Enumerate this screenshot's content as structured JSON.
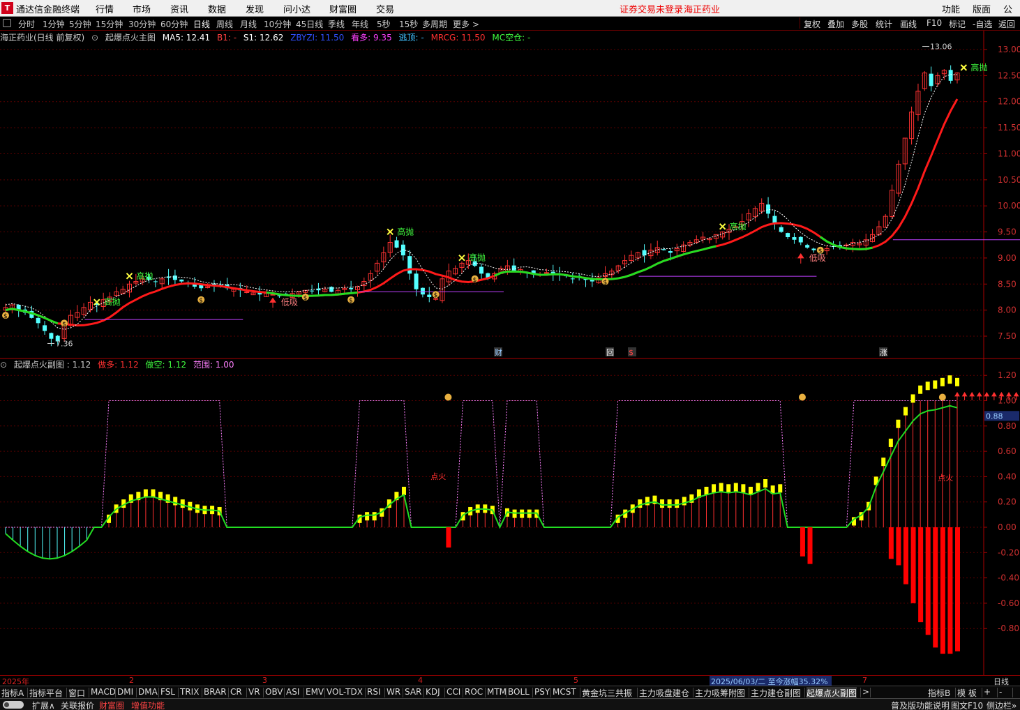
{
  "menubar": {
    "logo": "T",
    "app_title": "通达信金融终端",
    "items": [
      "行情",
      "市场",
      "资讯",
      "数据",
      "发现",
      "问小达",
      "财富圈",
      "交易"
    ],
    "login_status": "证券交易未登录",
    "stock_name": "海正药业",
    "right_items": [
      "功能",
      "版面",
      "公式"
    ]
  },
  "periodbar": {
    "periods": [
      "分时",
      "1分钟",
      "5分钟",
      "15分钟",
      "30分钟",
      "60分钟",
      "日线",
      "周线",
      "月线",
      "10分钟",
      "45日线",
      "季线",
      "年线",
      "5秒",
      "15秒",
      "多周期",
      "更多 >"
    ],
    "active": "日线",
    "right_buttons": [
      "复权",
      "叠加",
      "多股",
      "统计",
      "画线",
      "F10",
      "标记",
      "-自选",
      "返回"
    ]
  },
  "main_header": {
    "title": "海正药业(日线 前复权)",
    "indicator": "起爆点火主图",
    "ma5": "MA5: 12.41",
    "b1": "B1: -",
    "s1": "S1: 12.62",
    "zbyzi": "ZBYZI: 11.50",
    "kanduo": "看多: 9.35",
    "taoding": "逃顶: -",
    "mrcg": "MRCG: 11.50",
    "mckc": "MC空仓: -",
    "colors": {
      "title": "#cccccc",
      "b1": "#ff4040",
      "zbyzi": "#3050ff",
      "kanduo": "#ff40ff",
      "taoding": "#40c0ff",
      "mrcg": "#ff3030",
      "mckc": "#40ff40"
    }
  },
  "sub_header": {
    "title": "起爆点火副图 : 1.12",
    "zuoduo": "做多: 1.12",
    "zuokong": "做空: 1.12",
    "fanwei": "范围: 1.00"
  },
  "main_axis": [
    "13.00",
    "12.50",
    "12.00",
    "11.50",
    "11.00",
    "10.50",
    "10.00",
    "9.50",
    "9.00",
    "8.50",
    "8.00",
    "7.50"
  ],
  "sub_axis": [
    "1.20",
    "1.00",
    "0.80",
    "0.60",
    "0.40",
    "0.20",
    "0.00",
    "-0.20",
    "-0.40",
    "-0.60",
    "-0.80"
  ],
  "sub_axis_marker": "0.88",
  "annotations": {
    "high_price": "13.06",
    "low_price": "7.36",
    "gaopao": "高抛",
    "dixi": "低吸",
    "dianhuo": "点火",
    "cai": "财",
    "hui": "回",
    "zhang": "涨",
    "dollar": "$"
  },
  "timeaxis": {
    "labels": [
      "2025年",
      "2",
      "3",
      "4",
      "5",
      "7"
    ],
    "date_box": "2025/06/03/二  至今涨幅35.32%",
    "period": "日线"
  },
  "indicator_tabs": [
    "指标A",
    "指标平台",
    "窗口",
    "MACD",
    "DMI",
    "DMA",
    "FSL",
    "TRIX",
    "BRAR",
    "CR",
    "VR",
    "OBV",
    "ASI",
    "EMV",
    "VOL-TDX",
    "RSI",
    "WR",
    "SAR",
    "KDJ",
    "CCI",
    "ROC",
    "MTM",
    "BOLL",
    "PSY",
    "MCST",
    "黄金坑三共振",
    "主力吸盘建仓",
    "主力吸筹附图",
    "主力建仓副图",
    "起爆点火副图",
    ">",
    "指标B",
    "模 板",
    "+",
    "-"
  ],
  "indicator_active": "起爆点火副图",
  "statusbar": {
    "items": [
      "扩展∧",
      "关联报价",
      "财富圈",
      "增值功能"
    ],
    "right_items": [
      "普及版功能说明",
      "图文F10",
      "侧边栏»"
    ]
  },
  "chart_data": [
    {
      "type": "candlestick",
      "title": "海正药业(日线 前复权)",
      "ylim": [
        7.2,
        13.2
      ],
      "close": [
        8.05,
        8.1,
        8.0,
        7.95,
        7.85,
        7.75,
        7.6,
        7.45,
        7.4,
        7.7,
        7.9,
        7.95,
        8.05,
        8.15,
        8.1,
        8.2,
        8.25,
        8.35,
        8.4,
        8.5,
        8.55,
        8.6,
        8.58,
        8.55,
        8.6,
        8.62,
        8.58,
        8.55,
        8.5,
        8.45,
        8.42,
        8.45,
        8.48,
        8.45,
        8.42,
        8.4,
        8.38,
        8.35,
        8.33,
        8.3,
        8.32,
        8.3,
        8.28,
        8.3,
        8.32,
        8.35,
        8.38,
        8.36,
        8.38,
        8.4,
        8.35,
        8.38,
        8.42,
        8.4,
        8.45,
        8.55,
        8.7,
        8.9,
        9.1,
        9.3,
        9.2,
        9.05,
        8.7,
        8.4,
        8.3,
        8.25,
        8.22,
        8.6,
        8.75,
        8.8,
        8.9,
        8.95,
        8.85,
        8.7,
        8.6,
        8.7,
        8.8,
        8.85,
        8.75,
        8.78,
        8.72,
        8.7,
        8.68,
        8.72,
        8.7,
        8.68,
        8.65,
        8.6,
        8.62,
        8.58,
        8.55,
        8.62,
        8.7,
        8.75,
        8.85,
        8.95,
        9.05,
        9.1,
        9.05,
        9.15,
        9.2,
        9.15,
        9.1,
        9.18,
        9.25,
        9.3,
        9.35,
        9.4,
        9.38,
        9.45,
        9.5,
        9.55,
        9.6,
        9.7,
        9.85,
        9.95,
        10.05,
        9.85,
        9.65,
        9.5,
        9.4,
        9.35,
        9.3,
        9.2,
        9.15,
        9.1,
        9.18,
        9.22,
        9.2,
        9.25,
        9.3,
        9.28,
        9.35,
        9.45,
        9.6,
        9.8,
        10.3,
        10.8,
        11.3,
        11.8,
        12.2,
        12.55,
        12.3,
        12.5,
        12.6,
        12.4,
        12.55
      ],
      "ma_red_start": 8.0,
      "ma_red_end": 11.5
    },
    {
      "type": "bar",
      "title": "起爆点火副图",
      "ylim": [
        -1.1,
        1.3
      ],
      "values_up": [
        0,
        0,
        0,
        0,
        0,
        0,
        0,
        0,
        0,
        0,
        0,
        0,
        0,
        0,
        0.1,
        0.18,
        0.22,
        0.26,
        0.28,
        0.3,
        0.3,
        0.28,
        0.26,
        0.24,
        0.22,
        0.2,
        0.18,
        0.17,
        0.17,
        0.16,
        0,
        0,
        0,
        0,
        0,
        0,
        0,
        0,
        0,
        0,
        0,
        0,
        0,
        0,
        0,
        0,
        0,
        0,
        0.1,
        0.12,
        0.12,
        0.15,
        0.22,
        0.28,
        0.32,
        0,
        0,
        0,
        0,
        0,
        0,
        0,
        0.12,
        0.16,
        0.18,
        0.18,
        0.17,
        0,
        0.15,
        0.14,
        0.14,
        0.14,
        0.14,
        0,
        0,
        0,
        0,
        0,
        0,
        0,
        0,
        0,
        0,
        0.1,
        0.14,
        0.18,
        0.22,
        0.24,
        0.25,
        0.22,
        0.22,
        0.22,
        0.24,
        0.26,
        0.3,
        0.32,
        0.34,
        0.35,
        0.34,
        0.35,
        0.34,
        0.32,
        0.35,
        0.38,
        0.33,
        0.34,
        0,
        0,
        0,
        0,
        0,
        0,
        0,
        0,
        0,
        0.08,
        0.12,
        0.2,
        0.4,
        0.55,
        0.7,
        0.85,
        0.95,
        1.05,
        1.12,
        1.15,
        1.16,
        1.18,
        1.2,
        1.18
      ],
      "values_down": [
        -0.25,
        -0.3,
        -0.45,
        -0.6,
        -0.75,
        -0.85,
        -0.95,
        -1.0,
        -1.0,
        -0.98
      ],
      "pink_dotted_high": 1.0
    }
  ]
}
